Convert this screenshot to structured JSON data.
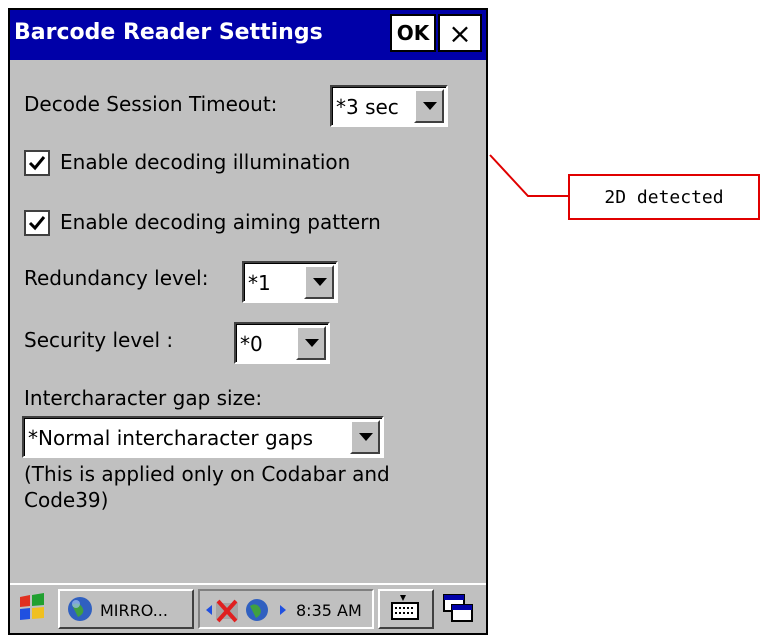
{
  "window": {
    "title": "Barcode Reader Settings",
    "ok_label": "OK",
    "close_label": "×"
  },
  "form": {
    "timeout_label": "Decode Session Timeout:",
    "timeout_value": "*3 sec",
    "illumination_label": "Enable decoding illumination",
    "illumination_checked": true,
    "aiming_label": "Enable decoding aiming pattern",
    "aiming_checked": true,
    "redundancy_label": "Redundancy level:",
    "redundancy_value": "*1",
    "security_label": "Security level :",
    "security_value": "*0",
    "gap_label": "Intercharacter gap size:",
    "gap_value": "*Normal intercharacter gaps",
    "note_line1": "(This is applied only on Codabar and",
    "note_line2": "Code39)"
  },
  "taskbar": {
    "task_label": "MIRRO...",
    "clock": "8:35 AM"
  },
  "callout": {
    "text": "2D detected",
    "color": "#e00000"
  },
  "colors": {
    "titlebar": "#0000a8",
    "surface": "#c0c0c0"
  }
}
